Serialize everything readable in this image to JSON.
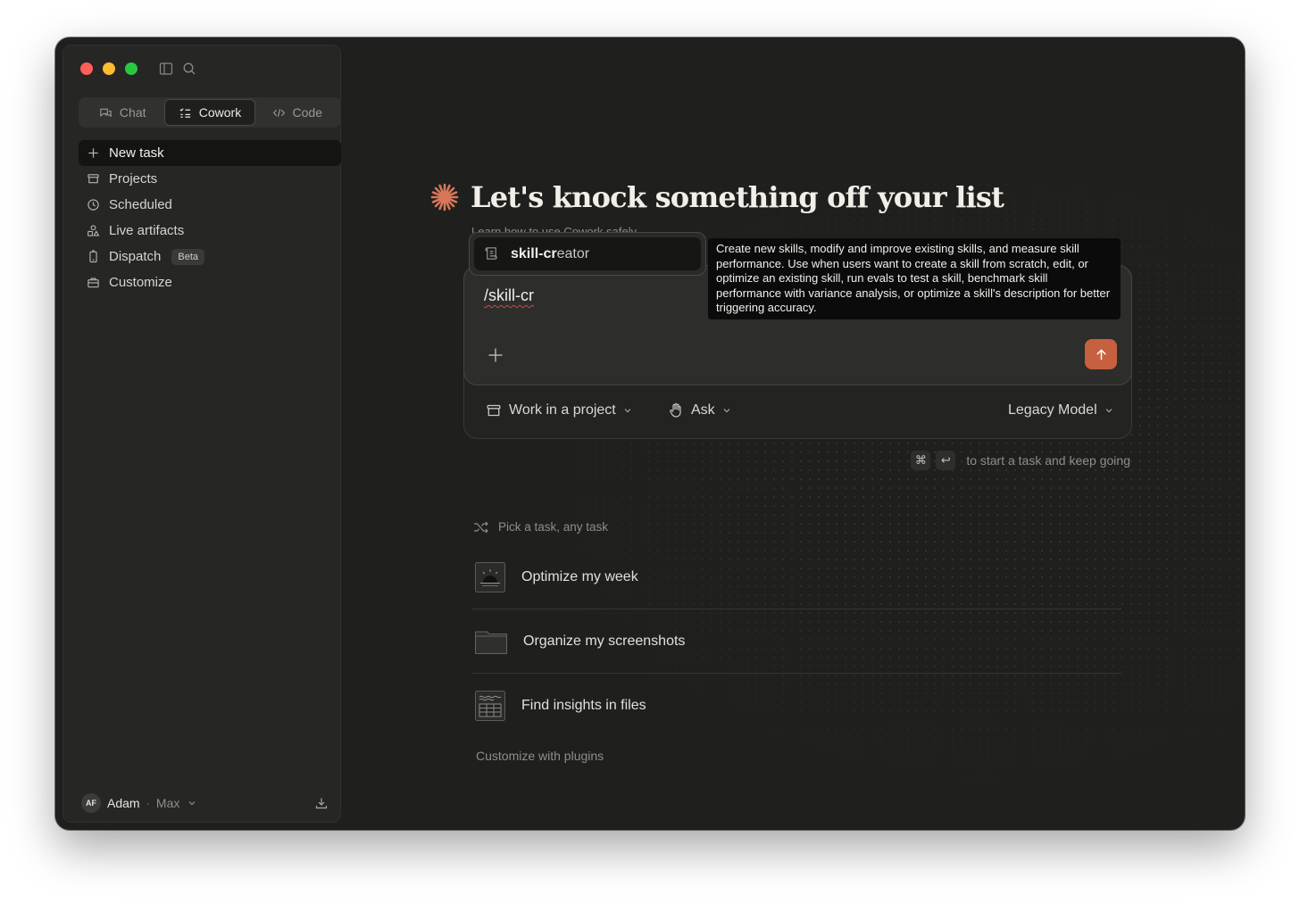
{
  "sidebar": {
    "modes": [
      {
        "label": "Chat",
        "icon": "chat-bubbles-icon",
        "active": false
      },
      {
        "label": "Cowork",
        "icon": "checklist-icon",
        "active": true
      },
      {
        "label": "Code",
        "icon": "code-brackets-icon",
        "active": false
      }
    ],
    "nav": [
      {
        "label": "New task",
        "icon": "plus-icon"
      },
      {
        "label": "Projects",
        "icon": "box-icon"
      },
      {
        "label": "Scheduled",
        "icon": "clock-icon"
      },
      {
        "label": "Live artifacts",
        "icon": "shapes-icon"
      },
      {
        "label": "Dispatch",
        "icon": "phone-icon",
        "badge": "Beta"
      },
      {
        "label": "Customize",
        "icon": "briefcase-icon"
      }
    ],
    "account": {
      "initials": "AF",
      "name": "Adam",
      "separator": "·",
      "plan": "Max"
    }
  },
  "main": {
    "headline": "Let's knock something off your list",
    "learn_link": "Learn how to use Cowork safely",
    "input_value": "/skill-cr",
    "options": {
      "project": "Work in a project",
      "mode": "Ask",
      "model": "Legacy Model"
    },
    "shortcut_hint": "to start a task and keep going",
    "shortcut_keys": [
      "⌘",
      "↩"
    ],
    "suggestions_header": "Pick a task, any task",
    "tasks": [
      {
        "label": "Optimize my week",
        "icon": "calendar-sunrise-icon"
      },
      {
        "label": "Organize my screenshots",
        "icon": "folder-icon"
      },
      {
        "label": "Find insights in files",
        "icon": "spreadsheet-icon"
      }
    ],
    "customize_link": "Customize with plugins"
  },
  "popup": {
    "item_bold": "skill-cr",
    "item_rest": "eator",
    "tooltip": "Create new skills, modify and improve existing skills, and measure skill performance. Use when users want to create a skill from scratch, edit, or optimize an existing skill, run evals to test a skill, benchmark skill performance with variance analysis, or optimize a skill's description for better triggering accuracy."
  },
  "colors": {
    "window_bg": "#1f1f1e",
    "sidebar_bg": "#262624",
    "accent": "#c6603f",
    "star": "#d9775a"
  }
}
